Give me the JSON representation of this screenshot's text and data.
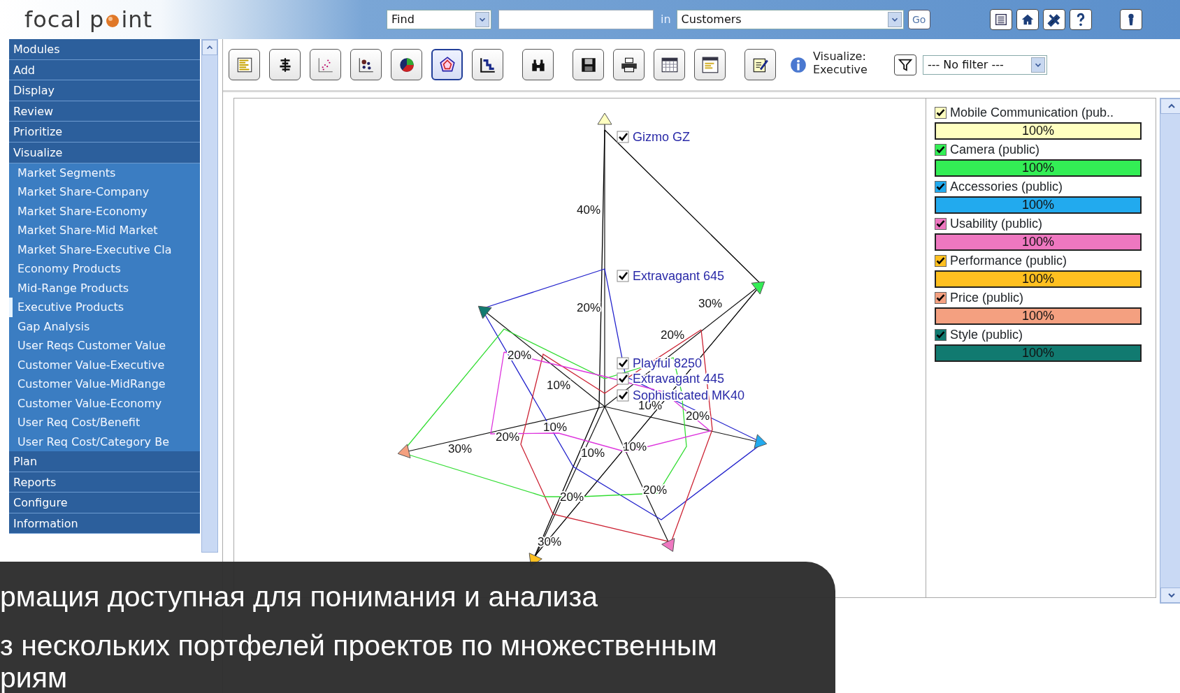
{
  "header": {
    "logo": {
      "before": "focal p",
      "after": "int"
    },
    "find_select": "Find",
    "in_label": "in",
    "scope_select": "Customers",
    "go_button": "Go"
  },
  "sidebar": {
    "sections": [
      {
        "label": "Modules"
      },
      {
        "label": "Add"
      },
      {
        "label": "Display"
      },
      {
        "label": "Review"
      },
      {
        "label": "Prioritize"
      },
      {
        "label": "Visualize",
        "children": [
          {
            "label": "Market Segments",
            "selected": false
          },
          {
            "label": "Market Share-Company",
            "selected": false
          },
          {
            "label": "Market Share-Economy",
            "selected": false
          },
          {
            "label": "Market Share-Mid Market",
            "selected": false
          },
          {
            "label": "Market Share-Executive Cla",
            "selected": false
          },
          {
            "label": "Economy Products",
            "selected": false
          },
          {
            "label": "Mid-Range Products",
            "selected": false
          },
          {
            "label": "Executive Products",
            "selected": true
          },
          {
            "label": "Gap Analysis",
            "selected": false
          },
          {
            "label": "User Reqs Customer Value",
            "selected": false
          },
          {
            "label": "Customer Value-Executive",
            "selected": false
          },
          {
            "label": "Customer Value-MidRange",
            "selected": false
          },
          {
            "label": "Customer Value-Economy",
            "selected": false
          },
          {
            "label": "User Req Cost/Benefit",
            "selected": false
          },
          {
            "label": "User Req Cost/Category Be",
            "selected": false
          }
        ]
      },
      {
        "label": "Plan"
      },
      {
        "label": "Reports"
      },
      {
        "label": "Configure"
      },
      {
        "label": "Information"
      }
    ]
  },
  "toolbar": {
    "buttons": [
      {
        "selected": false
      },
      {
        "selected": false
      },
      {
        "selected": false
      },
      {
        "selected": false
      },
      {
        "selected": false
      },
      {
        "selected": true
      },
      {
        "selected": false
      },
      {
        "selected": false
      },
      {
        "selected": false
      },
      {
        "selected": false
      },
      {
        "selected": false
      },
      {
        "selected": false
      },
      {
        "selected": false
      }
    ],
    "info_lines": [
      "Visualize:",
      "Executive"
    ],
    "filter_select": "--- No filter ---"
  },
  "chart": {
    "tick_labels": [
      "40%",
      "20%",
      "30%",
      "20%",
      "20%",
      "10%",
      "10%",
      "20%",
      "10%",
      "30%",
      "20%",
      "10%",
      "10%",
      "20%",
      "20%",
      "30%"
    ],
    "products": [
      {
        "label": "Gizmo GZ",
        "checked": true,
        "color": "#000000"
      },
      {
        "label": "Extravagant 645",
        "checked": true,
        "color": "#2222cc"
      },
      {
        "label": "Playful 8250",
        "checked": true,
        "color": "#cc2233"
      },
      {
        "label": "Extravagant 445",
        "checked": true,
        "color": "#33dd33"
      },
      {
        "label": "Sophisticated MK40",
        "checked": true,
        "color": "#dd33dd"
      }
    ]
  },
  "legend": [
    {
      "label": "Mobile Communication (pub..",
      "checked": true,
      "color": "#ffffc0",
      "reading": "100%",
      "level": 1
    },
    {
      "label": "Camera (public)",
      "checked": true,
      "color": "#33ee55",
      "reading": "100%",
      "level": 1
    },
    {
      "label": "Accessories (public)",
      "checked": true,
      "color": "#22aaee",
      "reading": "100%",
      "level": 1
    },
    {
      "label": "Usability (public)",
      "checked": true,
      "color": "#ee77c0",
      "reading": "100%",
      "level": 1
    },
    {
      "label": "Performance (public)",
      "checked": true,
      "color": "#ffc020",
      "reading": "100%",
      "level": 1
    },
    {
      "label": "Price (public)",
      "checked": true,
      "color": "#f4a080",
      "reading": "100%",
      "level": 1
    },
    {
      "label": "Style (public)",
      "checked": true,
      "color": "#117a70",
      "reading": "100%",
      "level": 1
    }
  ],
  "caption": {
    "lines": [
      "рмация доступная для понимания и анализа",
      "з нескольких портфелей проектов по множественным",
      "риям"
    ]
  }
}
